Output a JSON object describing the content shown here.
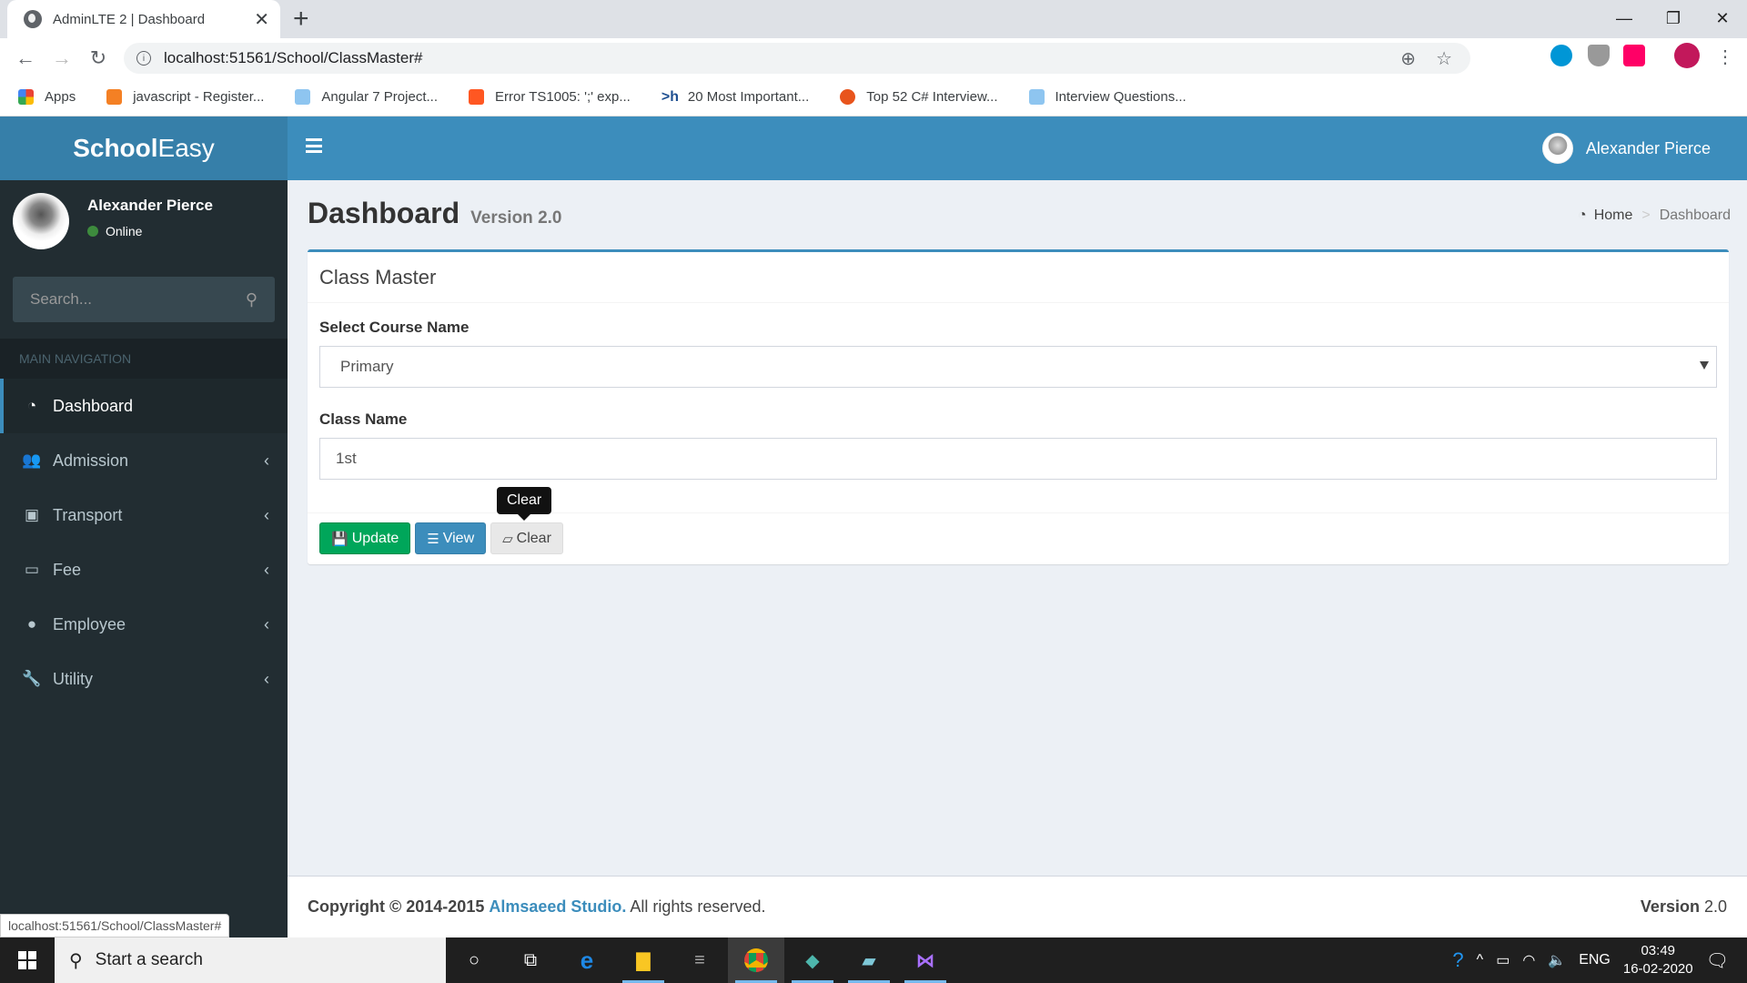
{
  "browser": {
    "tab_title": "AdminLTE 2 | Dashboard",
    "url": "localhost:51561/School/ClassMaster#",
    "bookmarks": [
      {
        "label": "Apps",
        "icon": "apps-grid-icon",
        "color": "#ea4335"
      },
      {
        "label": "javascript - Register...",
        "icon": "stackoverflow-icon",
        "color": "#f48024"
      },
      {
        "label": "Angular 7 Project...",
        "icon": "site-favicon-icon",
        "color": "#8ec5f0"
      },
      {
        "label": "Error TS1005: ';' exp...",
        "icon": "blogger-icon",
        "color": "#ff5722"
      },
      {
        "label": "20 Most Important...",
        "icon": "hackernoon-icon",
        "color": "#1e4f91"
      },
      {
        "label": "Top 52 C# Interview...",
        "icon": "guru99-icon",
        "color": "#e8541c"
      },
      {
        "label": "Interview Questions...",
        "icon": "site-favicon-icon",
        "color": "#8ec5f0"
      }
    ],
    "status_url": "localhost:51561/School/ClassMaster#"
  },
  "app": {
    "logo_bold": "School",
    "logo_light": "Easy",
    "header_user": "Alexander Pierce",
    "accent": "#3c8dbc"
  },
  "sidebar": {
    "user_name": "Alexander Pierce",
    "status": "Online",
    "search_placeholder": "Search...",
    "nav_header": "MAIN NAVIGATION",
    "items": [
      {
        "label": "Dashboard",
        "icon": "dashboard-icon",
        "active": true
      },
      {
        "label": "Admission",
        "icon": "users-icon"
      },
      {
        "label": "Transport",
        "icon": "bus-icon"
      },
      {
        "label": "Fee",
        "icon": "money-icon"
      },
      {
        "label": "Employee",
        "icon": "user-icon"
      },
      {
        "label": "Utility",
        "icon": "wrench-icon"
      }
    ]
  },
  "page": {
    "title": "Dashboard",
    "subtitle": "Version 2.0",
    "breadcrumb": {
      "home": "Home",
      "current": "Dashboard"
    }
  },
  "form": {
    "box_title": "Class Master",
    "course_label": "Select Course Name",
    "course_value": "Primary",
    "class_label": "Class Name",
    "class_value": "1st",
    "buttons": {
      "update": "Update",
      "view": "View",
      "clear": "Clear"
    },
    "tooltip": "Clear"
  },
  "footer": {
    "copyright_bold": "Copyright © 2014-2015",
    "company": "Almsaeed Studio.",
    "rights": "All rights reserved.",
    "version_label": "Version",
    "version_value": "2.0"
  },
  "taskbar": {
    "search_placeholder": "Start a search",
    "language": "ENG",
    "time": "03:49",
    "date": "16-02-2020"
  }
}
